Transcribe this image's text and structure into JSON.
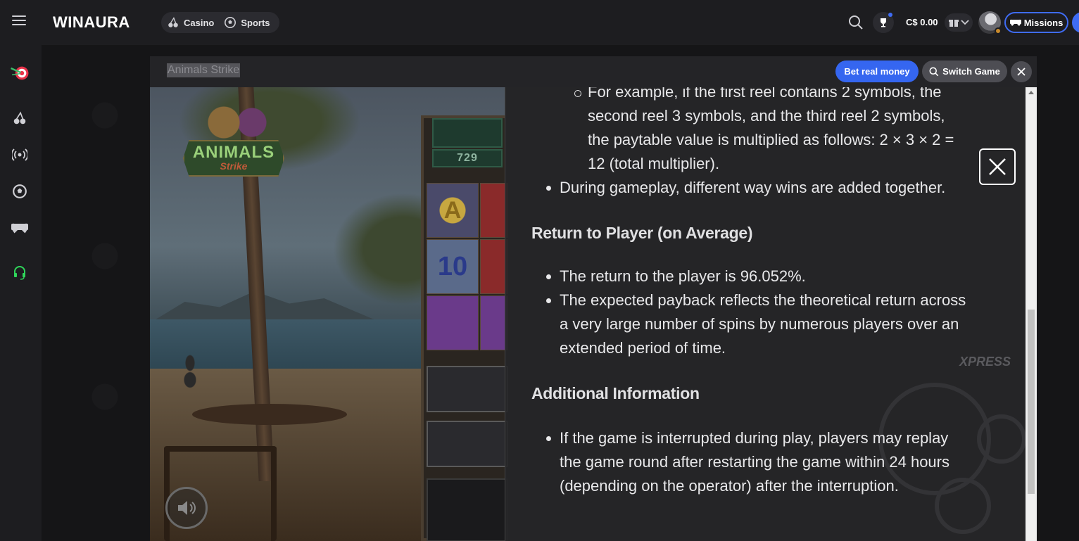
{
  "brand": {
    "logo_text": "WINAURA"
  },
  "topnav": {
    "casino_label": "Casino",
    "sports_label": "Sports",
    "balance": "C$ 0.00",
    "missions_label": "Missions"
  },
  "sidebar": {
    "items": [
      {
        "name": "darts"
      },
      {
        "name": "casino"
      },
      {
        "name": "live"
      },
      {
        "name": "sports"
      },
      {
        "name": "games"
      },
      {
        "name": "support"
      }
    ]
  },
  "game": {
    "title": "Animals Strike",
    "bet_real_label": "Bet real money",
    "switch_game_label": "Switch Game",
    "logo_line1": "ANIMALS",
    "logo_line2": "Strike",
    "ways_value": "729",
    "sym_a": "A",
    "sym_10": "10"
  },
  "paytable": {
    "sub_item": "For example, if the first reel contains 2 symbols, the second reel 3 symbols, and the third reel 2 symbols, the paytable value is multiplied as follows: 2 × 3 × 2 = 12 (total multiplier).",
    "way_wins": "During gameplay, different way wins are added together.",
    "rtp_heading": "Return to Player (on Average)",
    "rtp_value": "The return to the player is 96.052%.",
    "rtp_payback": "The expected payback reflects the theoretical return across a very large number of spins by numerous players over an extended period of time.",
    "info_heading": "Additional Information",
    "info_interrupt": "If the game is interrupted during play, players may replay the game round after restarting the game within 24 hours (depending on the operator) after the interruption."
  },
  "background": {
    "watermark": "XPRESS"
  },
  "colors": {
    "accent": "#3566f0",
    "support_green": "#2fd65a",
    "topbar_bg": "#1d1d20"
  }
}
